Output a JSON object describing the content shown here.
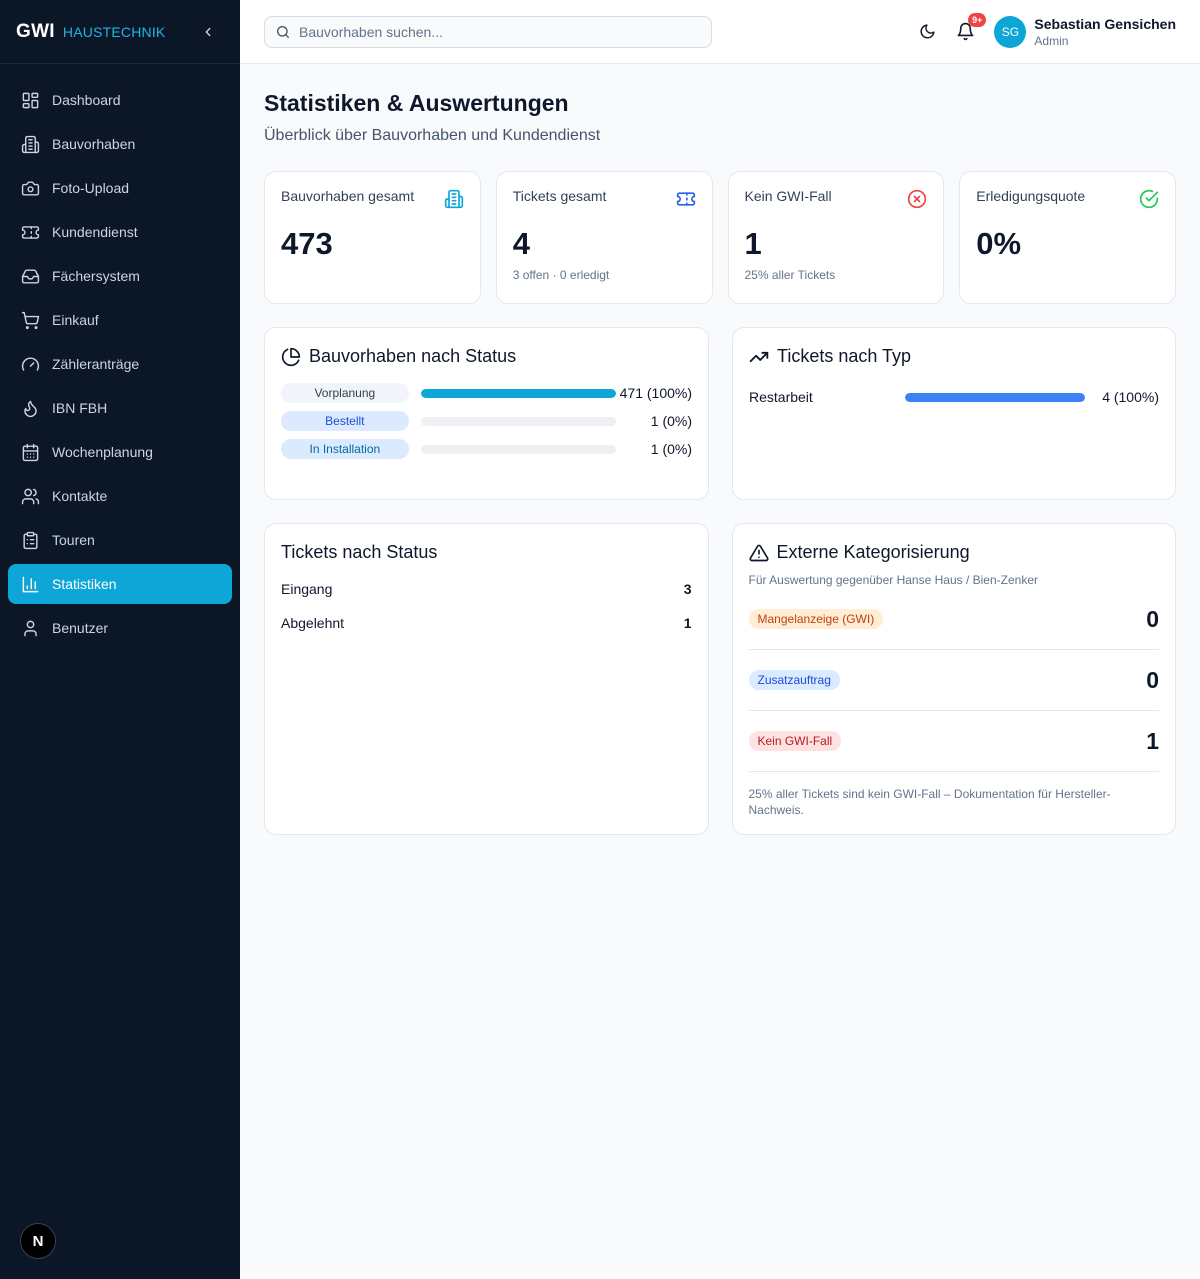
{
  "brand": {
    "name": "GWI",
    "sub": "HAUSTECHNIK"
  },
  "sidebar": {
    "items": [
      {
        "label": "Dashboard",
        "icon": "dashboard-icon",
        "active": false
      },
      {
        "label": "Bauvorhaben",
        "icon": "building-icon",
        "active": false
      },
      {
        "label": "Foto-Upload",
        "icon": "camera-icon",
        "active": false
      },
      {
        "label": "Kundendienst",
        "icon": "ticket-icon",
        "active": false
      },
      {
        "label": "Fächersystem",
        "icon": "inbox-icon",
        "active": false
      },
      {
        "label": "Einkauf",
        "icon": "cart-icon",
        "active": false
      },
      {
        "label": "Zähleranträge",
        "icon": "gauge-icon",
        "active": false
      },
      {
        "label": "IBN FBH",
        "icon": "flame-icon",
        "active": false
      },
      {
        "label": "Wochenplanung",
        "icon": "calendar-icon",
        "active": false
      },
      {
        "label": "Kontakte",
        "icon": "users-icon",
        "active": false
      },
      {
        "label": "Touren",
        "icon": "clipboard-icon",
        "active": false
      },
      {
        "label": "Statistiken",
        "icon": "bar-chart-icon",
        "active": true
      },
      {
        "label": "Benutzer",
        "icon": "user-icon",
        "active": false
      }
    ],
    "footer_logo": "N"
  },
  "header": {
    "search_placeholder": "Bauvorhaben suchen...",
    "notification_badge": "9+",
    "user": {
      "initials": "SG",
      "name": "Sebastian Gensichen",
      "role": "Admin"
    }
  },
  "page": {
    "title": "Statistiken & Auswertungen",
    "subtitle": "Überblick über Bauvorhaben und Kundendienst"
  },
  "kpis": [
    {
      "label": "Bauvorhaben gesamt",
      "value": "473",
      "sub": "",
      "icon": "building-icon",
      "color": "#0ea5d7"
    },
    {
      "label": "Tickets gesamt",
      "value": "4",
      "sub": "3 offen · 0 erledigt",
      "icon": "ticket-icon",
      "color": "#2563eb"
    },
    {
      "label": "Kein GWI-Fall",
      "value": "1",
      "sub": "25% aller Tickets",
      "icon": "x-circle-icon",
      "color": "#ef4444"
    },
    {
      "label": "Erledigungsquote",
      "value": "0%",
      "sub": "",
      "icon": "check-circle-icon",
      "color": "#22c55e"
    }
  ],
  "bauvorhaben_status": {
    "title": "Bauvorhaben nach Status",
    "rows": [
      {
        "label": "Vorplanung",
        "count": "471 (100%)",
        "fraction": 1.0,
        "pill_bg": "#f1f5f9",
        "pill_fg": "#334155",
        "bar": "#0ea5d7"
      },
      {
        "label": "Bestellt",
        "count": "1 (0%)",
        "fraction": 0.0,
        "pill_bg": "#dbeafe",
        "pill_fg": "#1d4ed8",
        "bar": "#0ea5d7"
      },
      {
        "label": "In Installation",
        "count": "1 (0%)",
        "fraction": 0.0,
        "pill_bg": "#dbeafe",
        "pill_fg": "#0369a1",
        "bar": "#0ea5d7"
      }
    ]
  },
  "tickets_typ": {
    "title": "Tickets nach Typ",
    "rows": [
      {
        "label": "Restarbeit",
        "count": "4 (100%)",
        "fraction": 1.0,
        "bar": "#3b82f6"
      }
    ]
  },
  "tickets_status": {
    "title": "Tickets nach Status",
    "rows": [
      {
        "label": "Eingang",
        "value": "3"
      },
      {
        "label": "Abgelehnt",
        "value": "1"
      }
    ]
  },
  "extern": {
    "title": "Externe Kategorisierung",
    "desc": "Für Auswertung gegenüber Hanse Haus / Bien-Zenker",
    "rows": [
      {
        "label": "Mangelanzeige (GWI)",
        "value": "0",
        "bg": "#ffedd5",
        "fg": "#c2410c"
      },
      {
        "label": "Zusatzauftrag",
        "value": "0",
        "bg": "#dbeafe",
        "fg": "#1d4ed8"
      },
      {
        "label": "Kein GWI-Fall",
        "value": "1",
        "bg": "#fee2e2",
        "fg": "#b91c1c"
      }
    ],
    "note": "25% aller Tickets sind kein GWI-Fall – Dokumentation für Hersteller-Nachweis."
  }
}
